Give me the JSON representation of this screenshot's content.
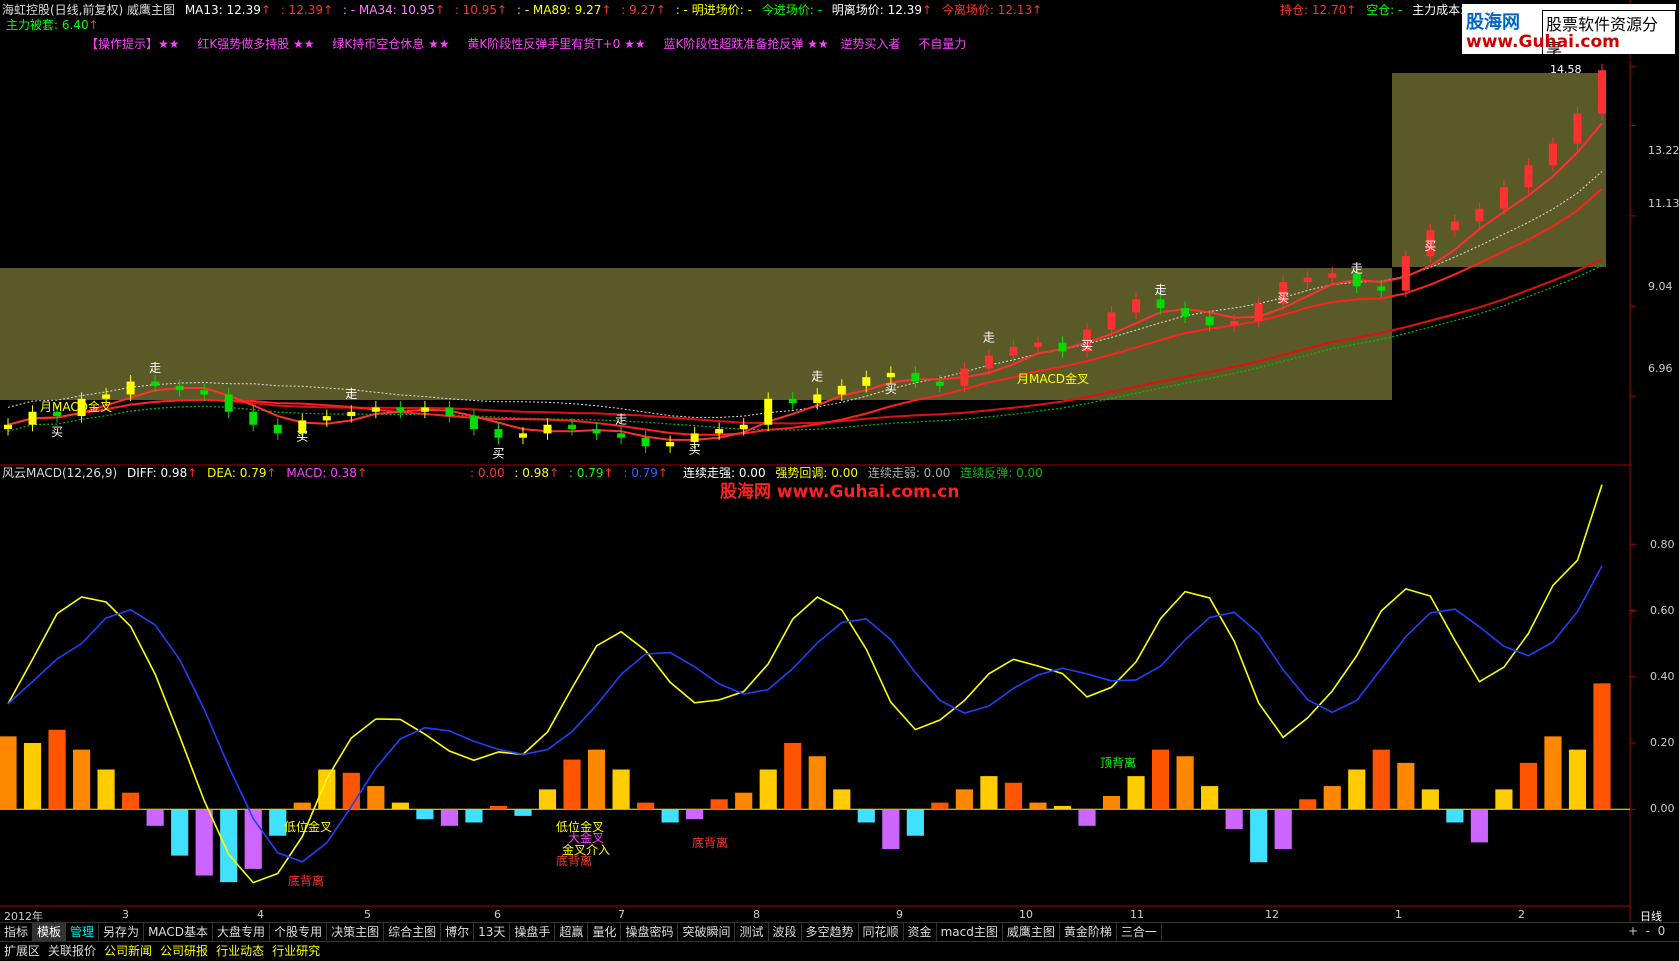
{
  "header": {
    "stock": "海虹控股(日线,前复权) 威鹰主图",
    "ma13": "MA13: 12.39",
    "ma13b": ": 12.39",
    "ma34": ": - MA34: 10.95",
    "ma34b": ": 10.95",
    "ma89": ": - MA89: 9.27",
    "ma89b": ": 9.27",
    "entry1": ": - 明进场价: -",
    "entry2": "今进场价: -",
    "exit1": "明离场价: 12.39",
    "exit2": "今离场价: 12.13",
    "hold": "持仓: 12.70",
    "empty": "空仓: -",
    "cost": "主力成本: 7",
    "trapped": "主力被套: 6.40"
  },
  "tips": {
    "t1": "【操作提示】★★",
    "t2": "红K强势做多持股 ★★",
    "t3": "绿K持币空仓休息 ★★",
    "t4": "黄K阶段性反弹手里有货T+0 ★★",
    "t5": "蓝K阶段性超跌准备抢反弹 ★★",
    "t6": "逆势买入者",
    "t7": "不自量力"
  },
  "price_axis": [
    "14.58",
    "13.22",
    "11.13",
    "9.04",
    "6.96"
  ],
  "macd_header": {
    "name": "风云MACD(12,26,9)",
    "diff": "DIFF: 0.98",
    "dea": "DEA: 0.79",
    "macd": "MACD: 0.38",
    "v1": ": 0.00",
    "v2": ": 0.98",
    "v3": ": 0.79",
    "v4": ": 0.79",
    "s1": "连续走强: 0.00",
    "s2": "强势回调: 0.00",
    "s3": "连续走弱: 0.00",
    "s4": "连续反弹: 0.00"
  },
  "watermark": "股海网 www.Guhai.com.cn",
  "macd_axis": [
    "0.80",
    "0.60",
    "0.40",
    "0.20",
    "0.00"
  ],
  "signals": {
    "buy": "买",
    "sell": "走",
    "month_cross": "月MACD金叉",
    "low_cross": "低位金叉",
    "bottom_div": "底背离",
    "top_div": "顶背离",
    "big_cross": "大金叉",
    "cross_in": "金叉介入"
  },
  "xaxis": [
    "2012年",
    "3",
    "4",
    "5",
    "6",
    "7",
    "8",
    "9",
    "10",
    "11",
    "12",
    "1",
    "2"
  ],
  "period": "日线",
  "tabs": [
    "指标",
    "模板",
    "管理",
    "另存为",
    "MACD基本",
    "大盘专用",
    "个股专用",
    "决策主图",
    "综合主图",
    "博尔",
    "13天",
    "操盘手",
    "超赢",
    "量化",
    "操盘密码",
    "突破瞬间",
    "测试",
    "波段",
    "多空趋势",
    "同花顺",
    "资金",
    "macd主图",
    "威鹰主图",
    "黄金阶梯",
    "三合一"
  ],
  "tabs2": [
    "扩展区",
    "关联报价",
    "公司新闻",
    "公司研报",
    "行业动态",
    "行业研究"
  ],
  "logo": {
    "brand": "股海网",
    "slogan": "股票软件资源分享",
    "url": "www.Guhai.com"
  },
  "chart_data": [
    {
      "type": "candlestick",
      "title": "海虹控股(日线,前复权) 威鹰主图",
      "y_ticks": [
        6.96,
        9.04,
        11.13,
        13.22,
        14.58
      ],
      "ylim": [
        5.6,
        15.2
      ],
      "x_ticks": [
        "2012年",
        "3",
        "4",
        "5",
        "6",
        "7",
        "8",
        "9",
        "10",
        "11",
        "12",
        "1",
        "2"
      ],
      "close": [
        6.3,
        6.6,
        6.5,
        6.9,
        7.0,
        7.3,
        7.2,
        7.1,
        7.0,
        6.6,
        6.3,
        6.1,
        6.4,
        6.5,
        6.6,
        6.7,
        6.6,
        6.7,
        6.5,
        6.2,
        6.0,
        6.1,
        6.3,
        6.2,
        6.1,
        6.0,
        5.8,
        5.9,
        6.1,
        6.2,
        6.3,
        6.9,
        6.8,
        7.0,
        7.2,
        7.4,
        7.5,
        7.3,
        7.2,
        7.6,
        7.9,
        8.1,
        8.2,
        8.0,
        8.5,
        8.9,
        9.2,
        9.0,
        8.8,
        8.6,
        8.7,
        9.1,
        9.6,
        9.7,
        9.8,
        9.5,
        9.4,
        10.2,
        10.8,
        11.0,
        11.3,
        11.8,
        12.3,
        12.8,
        13.5,
        14.5
      ],
      "series": [
        {
          "name": "MA13",
          "last": 12.39
        },
        {
          "name": "MA34",
          "last": 10.95
        },
        {
          "name": "MA89",
          "last": 9.27
        }
      ]
    },
    {
      "type": "bar",
      "title": "风云MACD(12,26,9)",
      "y_ticks": [
        0.0,
        0.2,
        0.4,
        0.6,
        0.8
      ],
      "ylim": [
        -0.28,
        1.0
      ],
      "macd": [
        0.22,
        0.2,
        0.24,
        0.18,
        0.12,
        0.05,
        -0.05,
        -0.14,
        -0.2,
        -0.22,
        -0.18,
        -0.08,
        0.02,
        0.12,
        0.11,
        0.07,
        0.02,
        -0.03,
        -0.05,
        -0.04,
        0.01,
        -0.02,
        0.06,
        0.15,
        0.18,
        0.12,
        0.02,
        -0.04,
        -0.03,
        0.03,
        0.05,
        0.12,
        0.2,
        0.16,
        0.06,
        -0.04,
        -0.12,
        -0.08,
        0.02,
        0.06,
        0.1,
        0.08,
        0.02,
        0.01,
        -0.05,
        0.04,
        0.1,
        0.18,
        0.16,
        0.07,
        -0.06,
        -0.16,
        -0.12,
        0.03,
        0.07,
        0.12,
        0.18,
        0.14,
        0.06,
        -0.04,
        -0.1,
        0.06,
        0.14,
        0.22,
        0.18,
        0.38
      ],
      "series": [
        {
          "name": "DIFF",
          "last": 0.98
        },
        {
          "name": "DEA",
          "last": 0.79
        },
        {
          "name": "MACD",
          "last": 0.38
        }
      ]
    }
  ]
}
